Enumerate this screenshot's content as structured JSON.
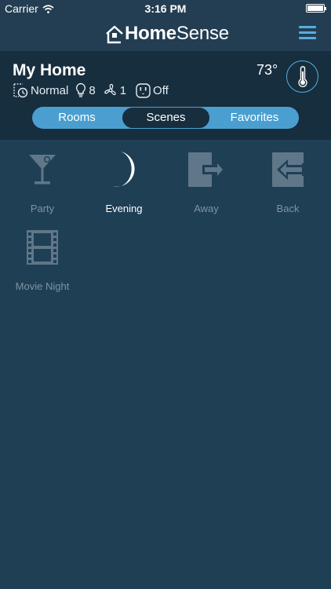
{
  "status_bar": {
    "carrier": "Carrier",
    "time": "3:16 PM"
  },
  "app": {
    "logo_part1": "Home",
    "logo_part2": "Sense",
    "menu_icon": "hamburger-icon"
  },
  "home": {
    "title": "My Home",
    "temperature": "73°",
    "mode": "Normal",
    "lights_count": "8",
    "fans_count": "1",
    "outlet_state": "Off"
  },
  "tabs": [
    {
      "label": "Rooms",
      "selected": false
    },
    {
      "label": "Scenes",
      "selected": true
    },
    {
      "label": "Favorites",
      "selected": false
    }
  ],
  "scenes": [
    {
      "label": "Party",
      "icon": "cocktail-icon",
      "active": false
    },
    {
      "label": "Evening",
      "icon": "moon-icon",
      "active": true
    },
    {
      "label": "Away",
      "icon": "exit-door-icon",
      "active": false
    },
    {
      "label": "Back",
      "icon": "enter-door-icon",
      "active": false
    },
    {
      "label": "Movie Night",
      "icon": "film-strip-icon",
      "active": false
    }
  ],
  "colors": {
    "background": "#1f3f55",
    "header": "#172e3e",
    "accent": "#56aee0",
    "inactive_icon": "#5f7788"
  }
}
